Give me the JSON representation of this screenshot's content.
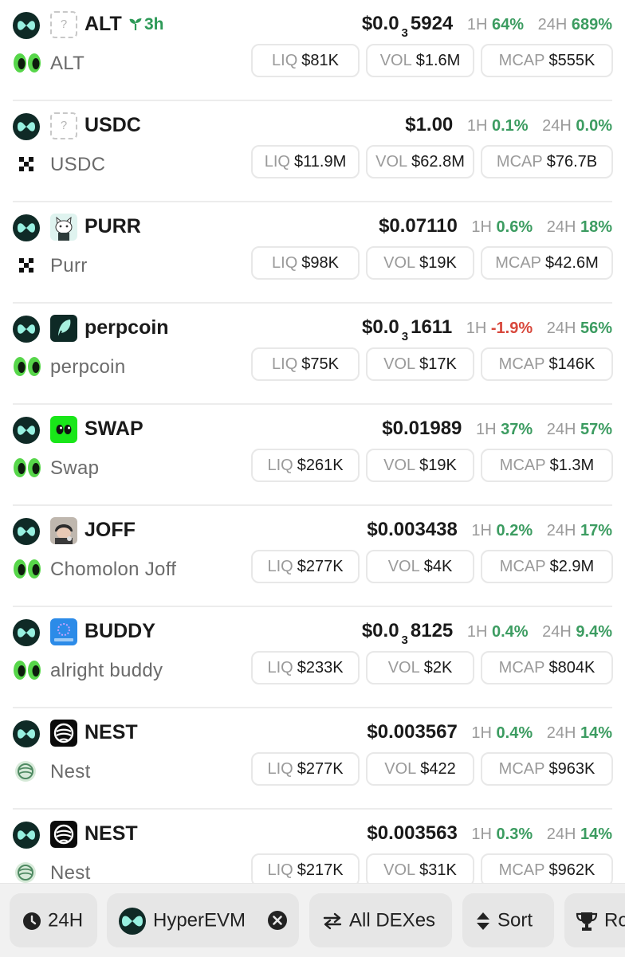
{
  "tokens": [
    {
      "symbol": "ALT",
      "age": "3h",
      "name": "ALT",
      "price_main": "$0.0",
      "price_sub": "3",
      "price_tail": "5924",
      "h1_label": "1H",
      "h1": "64%",
      "h24_label": "24H",
      "h24": "689%",
      "liq_label": "LIQ",
      "liq": "$81K",
      "vol_label": "VOL",
      "vol": "$1.6M",
      "mcap_label": "MCAP",
      "mcap": "$555K",
      "image": "unknown-token-icon",
      "dex": "eyes-dex-icon"
    },
    {
      "symbol": "USDC",
      "name": "USDC",
      "price_main": "$1.00",
      "h1_label": "1H",
      "h1": "0.1%",
      "h24_label": "24H",
      "h24": "0.0%",
      "liq_label": "LIQ",
      "liq": "$11.9M",
      "vol_label": "VOL",
      "vol": "$62.8M",
      "mcap_label": "MCAP",
      "mcap": "$76.7B",
      "image": "unknown-token-icon",
      "dex": "x-dex-icon"
    },
    {
      "symbol": "PURR",
      "name": "Purr",
      "price_main": "$0.07110",
      "h1_label": "1H",
      "h1": "0.6%",
      "h24_label": "24H",
      "h24": "18%",
      "liq_label": "LIQ",
      "liq": "$98K",
      "vol_label": "VOL",
      "vol": "$19K",
      "mcap_label": "MCAP",
      "mcap": "$42.6M",
      "image": "purr-cat-icon",
      "dex": "x-dex-icon"
    },
    {
      "symbol": "perpcoin",
      "name": "perpcoin",
      "price_main": "$0.0",
      "price_sub": "3",
      "price_tail": "1611",
      "h1_label": "1H",
      "h1": "-1.9%",
      "h1_negative": true,
      "h24_label": "24H",
      "h24": "56%",
      "liq_label": "LIQ",
      "liq": "$75K",
      "vol_label": "VOL",
      "vol": "$17K",
      "mcap_label": "MCAP",
      "mcap": "$146K",
      "image": "perpcoin-leaf-icon",
      "dex": "eyes-dex-icon"
    },
    {
      "symbol": "SWAP",
      "name": "Swap",
      "price_main": "$0.01989",
      "h1_label": "1H",
      "h1": "37%",
      "h24_label": "24H",
      "h24": "57%",
      "liq_label": "LIQ",
      "liq": "$261K",
      "vol_label": "VOL",
      "vol": "$19K",
      "mcap_label": "MCAP",
      "mcap": "$1.3M",
      "image": "swap-eyes-icon",
      "dex": "eyes-dex-icon"
    },
    {
      "symbol": "JOFF",
      "name": "Chomolon Joff",
      "price_main": "$0.003438",
      "h1_label": "1H",
      "h1": "0.2%",
      "h24_label": "24H",
      "h24": "17%",
      "liq_label": "LIQ",
      "liq": "$277K",
      "vol_label": "VOL",
      "vol": "$4K",
      "mcap_label": "MCAP",
      "mcap": "$2.9M",
      "image": "joff-character-icon",
      "dex": "eyes-dex-icon"
    },
    {
      "symbol": "BUDDY",
      "name": "alright buddy",
      "price_main": "$0.0",
      "price_sub": "3",
      "price_tail": "8125",
      "h1_label": "1H",
      "h1": "0.4%",
      "h24_label": "24H",
      "h24": "9.4%",
      "liq_label": "LIQ",
      "liq": "$233K",
      "vol_label": "VOL",
      "vol": "$2K",
      "mcap_label": "MCAP",
      "mcap": "$804K",
      "image": "buddy-icon",
      "dex": "eyes-dex-icon"
    },
    {
      "symbol": "NEST",
      "name": "Nest",
      "price_main": "$0.003567",
      "h1_label": "1H",
      "h1": "0.4%",
      "h24_label": "24H",
      "h24": "14%",
      "liq_label": "LIQ",
      "liq": "$277K",
      "vol_label": "VOL",
      "vol": "$422",
      "mcap_label": "MCAP",
      "mcap": "$963K",
      "image": "nest-icon",
      "dex": "nest-dex-icon"
    },
    {
      "symbol": "NEST",
      "name": "Nest",
      "price_main": "$0.003563",
      "h1_label": "1H",
      "h1": "0.3%",
      "h24_label": "24H",
      "h24": "14%",
      "liq_label": "LIQ",
      "liq": "$217K",
      "vol_label": "VOL",
      "vol": "$31K",
      "mcap_label": "MCAP",
      "mcap": "$962K",
      "image": "nest-icon",
      "dex": "nest-dex-icon"
    }
  ],
  "chain_icon": "hyperevm-icon",
  "colors": {
    "positive": "#3c9c61",
    "negative": "#d8483c",
    "chain_bg": "#0f2a26",
    "chain_fg": "#97f0e0"
  },
  "bottom_bar": {
    "timeframe": {
      "label": "24H",
      "icon": "clock-icon"
    },
    "chain": {
      "label": "HyperEVM",
      "icon": "hyperevm-icon",
      "clear_icon": "close-circle-icon"
    },
    "dexes": {
      "label": "All DEXes",
      "icon": "swap-arrows-icon"
    },
    "sort": {
      "label": "Sort",
      "icon": "sort-icon"
    },
    "rank": {
      "label": "Ro",
      "icon": "trophy-icon"
    }
  }
}
